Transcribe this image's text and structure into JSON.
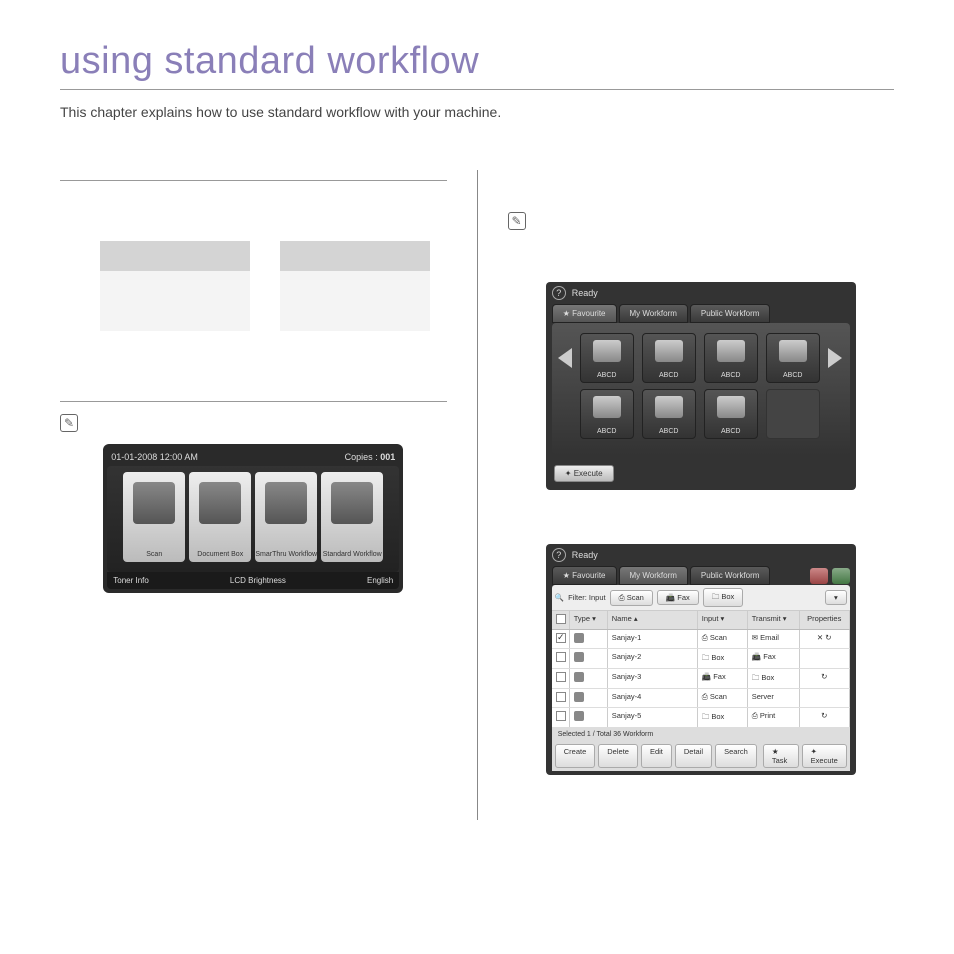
{
  "page": {
    "title": "using standard workflow",
    "intro": "This chapter explains how to use standard workflow with your machine."
  },
  "screenshot1": {
    "datetime": "01-01-2008 12:00 AM",
    "copies_label": "Copies :",
    "copies_value": "001",
    "cards": [
      "Scan",
      "Document Box",
      "SmarThru Workflow",
      "Standard Workflow"
    ],
    "footer": {
      "left": "Toner Info",
      "mid": "LCD Brightness",
      "right": "English"
    }
  },
  "screenshot2": {
    "ready": "Ready",
    "tabs": [
      "Favourite",
      "My Workform",
      "Public Workform"
    ],
    "tiles_row1": [
      "ABCD",
      "ABCD",
      "ABCD",
      "ABCD"
    ],
    "tiles_row2": [
      "ABCD",
      "ABCD",
      "ABCD"
    ],
    "execute": "Execute"
  },
  "screenshot3": {
    "ready": "Ready",
    "tabs": [
      "Favourite",
      "My Workform",
      "Public Workform"
    ],
    "filter_label": "Filter: Input",
    "filter_btns": [
      "Scan",
      "Fax",
      "Box"
    ],
    "columns": [
      "",
      "Type",
      "Name",
      "Input",
      "Transmit",
      "Properties"
    ],
    "rows": [
      {
        "checked": true,
        "name": "Sanjay-1",
        "input": "Scan",
        "transmit": "Email",
        "prop": "✕ ↻"
      },
      {
        "checked": false,
        "name": "Sanjay-2",
        "input": "Box",
        "transmit": "Fax",
        "prop": ""
      },
      {
        "checked": false,
        "name": "Sanjay-3",
        "input": "Fax",
        "transmit": "Box",
        "prop": "↻"
      },
      {
        "checked": false,
        "name": "Sanjay-4",
        "input": "Scan",
        "transmit": "Server",
        "prop": ""
      },
      {
        "checked": false,
        "name": "Sanjay-5",
        "input": "Box",
        "transmit": "Print",
        "prop": "↻"
      }
    ],
    "selected": "Selected 1 / Total 36 Workform",
    "footer_btns": [
      "Create",
      "Delete",
      "Edit",
      "Detail",
      "Search"
    ],
    "footer_right": [
      "Task",
      "Execute"
    ]
  }
}
